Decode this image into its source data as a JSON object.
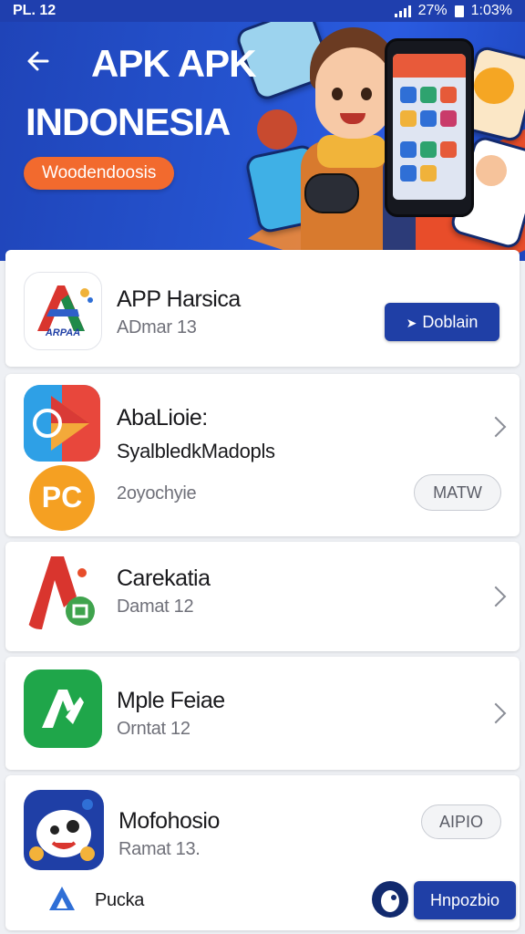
{
  "status_bar": {
    "left_text": "PL. 12",
    "battery_percent": "27%",
    "time": "1:03%"
  },
  "hero": {
    "title": "APK APK",
    "subtitle": "INDONESIA",
    "pill_label": "Woodendoosis",
    "back_icon": "arrow-left-icon"
  },
  "apps": [
    {
      "title": "APP Harsica",
      "subtitle": "ADmar 13",
      "icon_text": "ARPAA",
      "action_type": "button",
      "action_label": "Doblain",
      "action_icon": "arrow-right-icon"
    },
    {
      "title": "AbaLioie:",
      "subtitle": "SyalbledkMadopls",
      "secondary_subtitle": "2oyochyie",
      "action_type": "pill",
      "action_label": "MATW",
      "chevron": "chevron-right-icon"
    },
    {
      "title": "Carekatia",
      "subtitle": "Damat 12",
      "chevron": "chevron-right-icon"
    },
    {
      "title": "Mple Feiae",
      "subtitle": "Orntat 12",
      "chevron": "chevron-right-icon"
    },
    {
      "title": "Mofohosio",
      "subtitle": "Ramat 13.",
      "action_type": "pill",
      "action_label": "AIPIO"
    }
  ],
  "footer_row": {
    "label": "Pucka",
    "button_label": "Hnpozbio"
  },
  "colors": {
    "primary": "#1f3fa6",
    "hero_bg": "#2553cf",
    "accent_orange": "#f26a2e"
  }
}
